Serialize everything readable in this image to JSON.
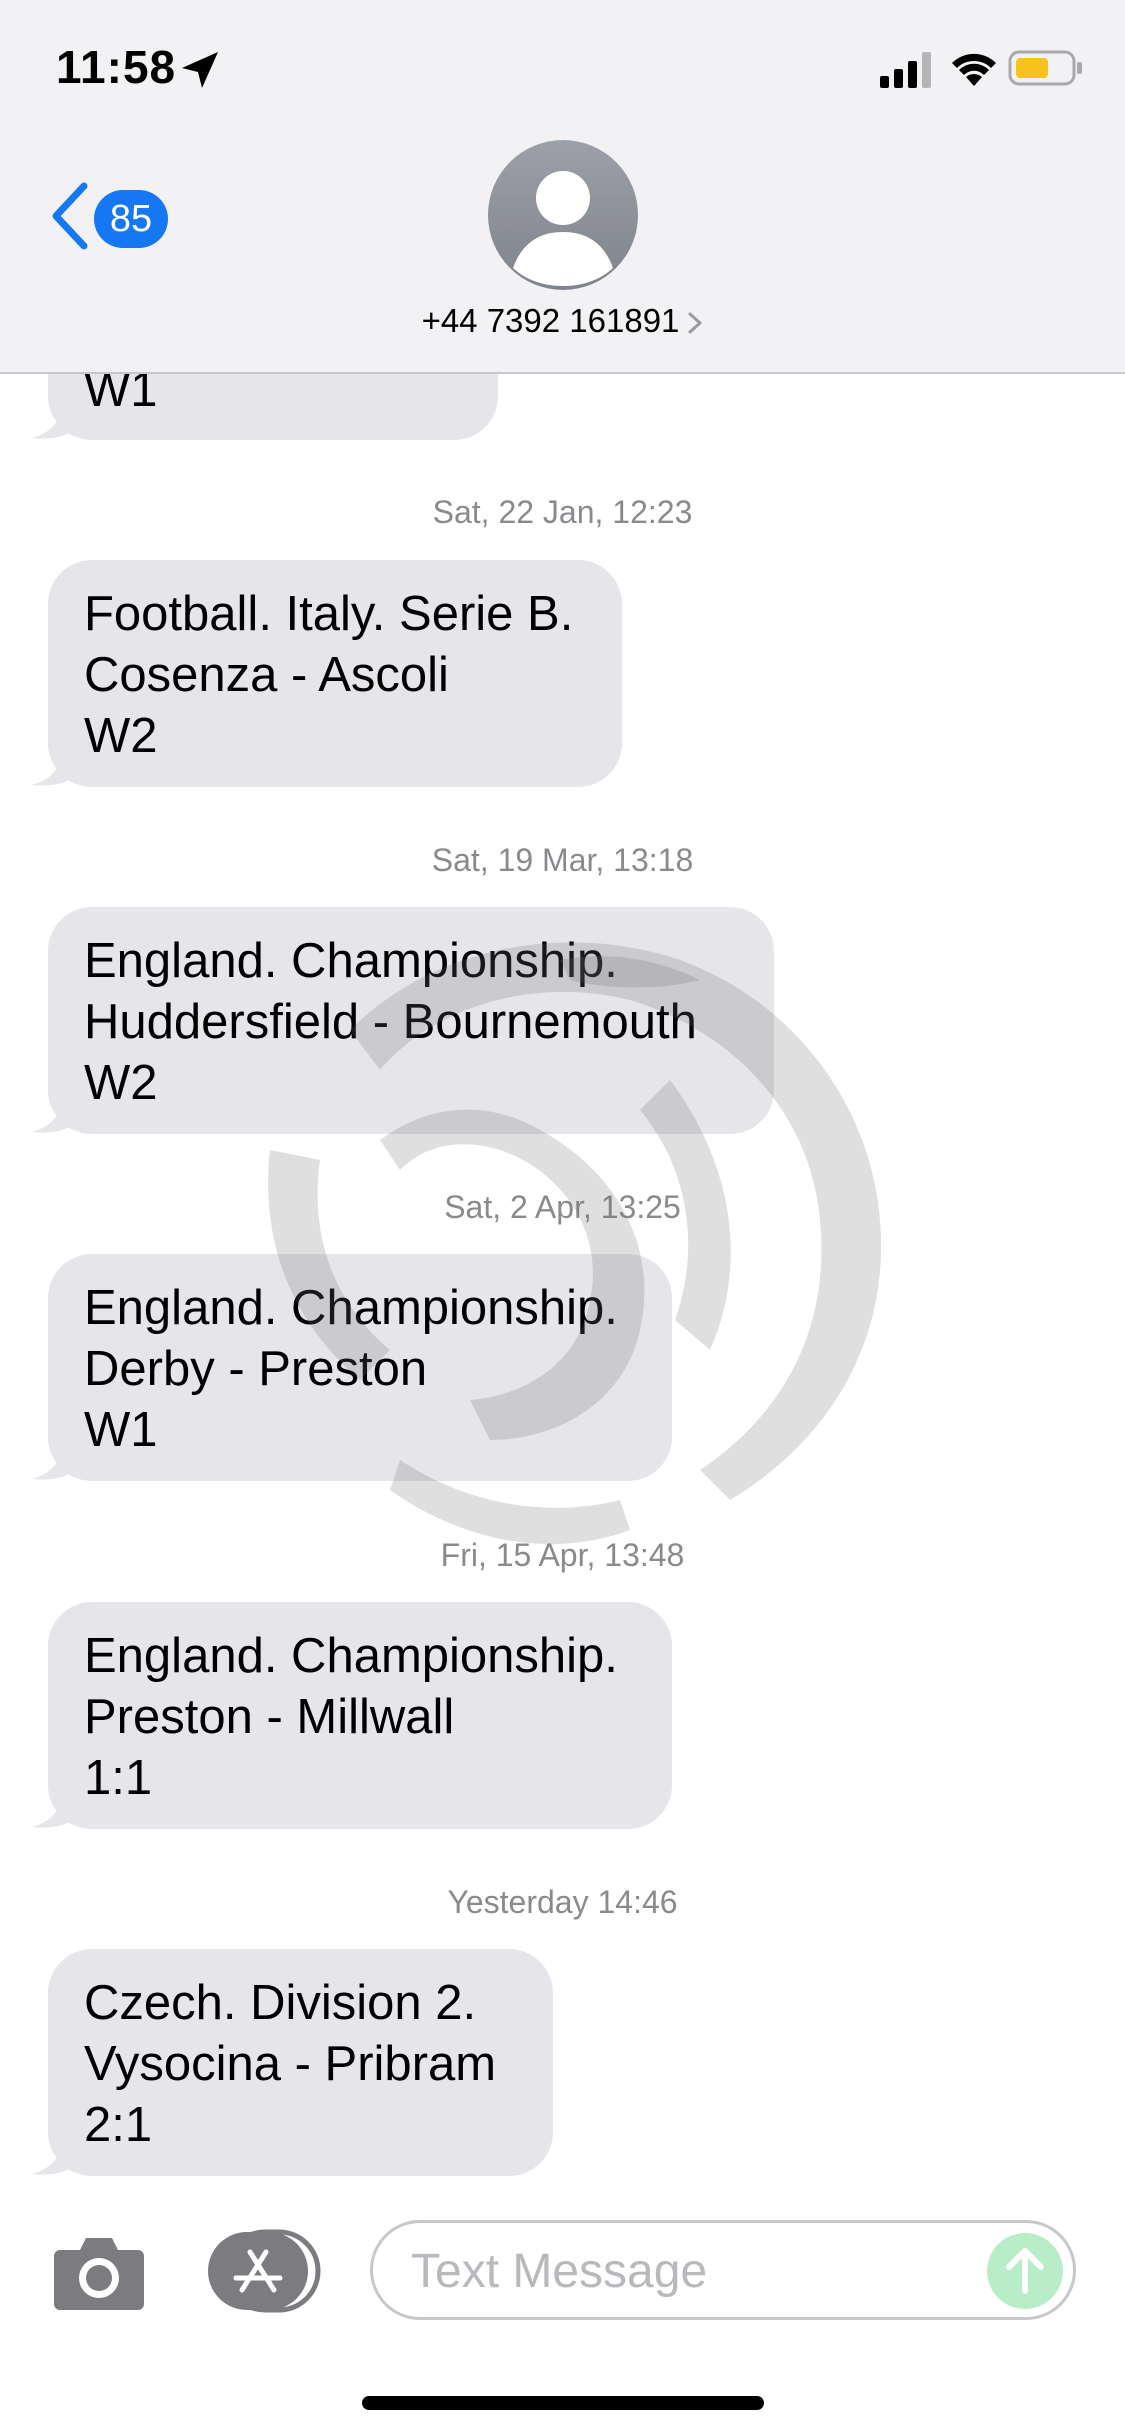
{
  "status_bar": {
    "time": "11:58",
    "battery_color": "#f7c31e"
  },
  "header": {
    "back_badge_count": "85",
    "contact_number": "+44 7392 161891"
  },
  "conversation": {
    "partial_message_last_line": "W1",
    "messages": [
      {
        "timestamp": "Sat, 22 Jan, 12:23",
        "lines": [
          "Football. Italy. Serie B.",
          "Cosenza - Ascoli",
          "W2"
        ]
      },
      {
        "timestamp": "Sat, 19 Mar, 13:18",
        "lines": [
          "England. Championship.",
          "Huddersfield - Bournemouth",
          "W2"
        ]
      },
      {
        "timestamp": "Sat, 2 Apr, 13:25",
        "lines": [
          "England. Championship.",
          "Derby - Preston",
          "W1"
        ]
      },
      {
        "timestamp": "Fri, 15 Apr, 13:48",
        "lines": [
          "England. Championship.",
          "Preston - Millwall",
          "1:1"
        ]
      },
      {
        "timestamp": "Yesterday 14:46",
        "lines": [
          "Czech. Division 2.",
          "Vysocina - Pribram",
          "2:1"
        ]
      }
    ]
  },
  "input_bar": {
    "placeholder": "Text Message",
    "value": "",
    "send_button_color": "#b9edc8"
  },
  "colors": {
    "accent_blue": "#1677f2",
    "received_bubble": "#e5e5ea",
    "timestamp_gray": "#8a8a8e"
  },
  "icons": {
    "location": "location-arrow-icon",
    "signal": "cellular-signal-icon",
    "wifi": "wifi-icon",
    "battery": "battery-icon",
    "back": "chevron-left-icon",
    "avatar": "person-silhouette-icon",
    "camera": "camera-icon",
    "apps": "app-store-icon",
    "send": "arrow-up-icon"
  }
}
